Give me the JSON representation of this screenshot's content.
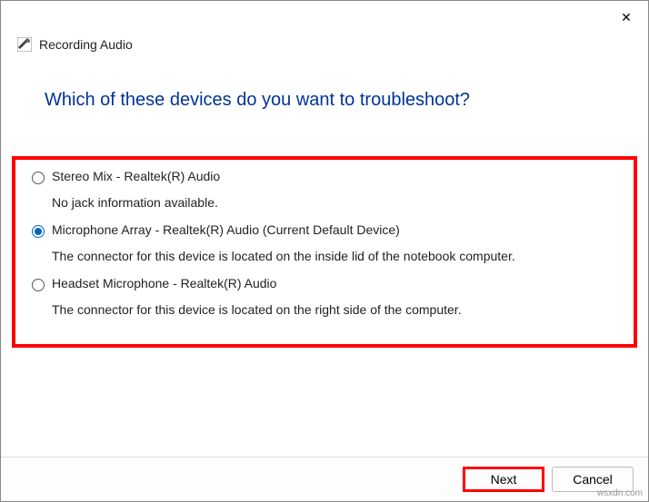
{
  "titlebar": {
    "close_symbol": "✕"
  },
  "header": {
    "title": "Recording Audio"
  },
  "question": "Which of these devices do you want to troubleshoot?",
  "options": [
    {
      "label": "Stereo Mix - Realtek(R) Audio",
      "description": "No jack information available.",
      "selected": false
    },
    {
      "label": "Microphone Array - Realtek(R) Audio (Current Default Device)",
      "description": "The connector for this device is located on the inside lid of the notebook computer.",
      "selected": true
    },
    {
      "label": "Headset Microphone - Realtek(R) Audio",
      "description": "The connector for this device is located on the right side of the computer.",
      "selected": false
    }
  ],
  "footer": {
    "next": "Next",
    "cancel": "Cancel"
  },
  "watermark": "wsxdn.com"
}
